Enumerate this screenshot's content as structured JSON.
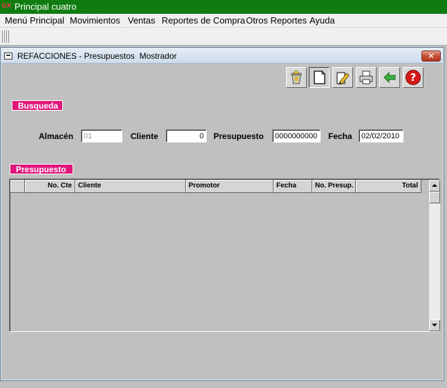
{
  "app": {
    "badge": "GX",
    "title": "Principal cuatro"
  },
  "menu": [
    "Menú Principal",
    "Movimientos",
    "Ventas",
    "Reportes de Compra",
    "Otros Reportes",
    "Ayuda"
  ],
  "window": {
    "title": "REFACCIONES - Presupuestos  Mostrador",
    "close_glyph": "✕"
  },
  "toolbar_icons": [
    "delete-bin-icon",
    "new-document-icon",
    "edit-pencil-icon",
    "printer-icon",
    "back-arrow-icon",
    "help-icon"
  ],
  "busqueda": {
    "section_label": "Busqueda",
    "almacen_label": "Almacén",
    "almacen_value": "01",
    "cliente_label": "Cliente",
    "cliente_value": "0",
    "presupuesto_label": "Presupuesto",
    "presupuesto_value": "0000000000",
    "fecha_label": "Fecha",
    "fecha_value": "02/02/2010"
  },
  "presupuesto": {
    "section_label": "Presupuesto",
    "columns": [
      "",
      "No. Cte",
      "Cliente",
      "Promotor",
      "Fecha",
      "No. Presup.",
      "Total"
    ],
    "rows": []
  },
  "colors": {
    "title_green": "#107c10",
    "section_magenta": "#e0167a",
    "window_gray": "#c0c0c0"
  }
}
